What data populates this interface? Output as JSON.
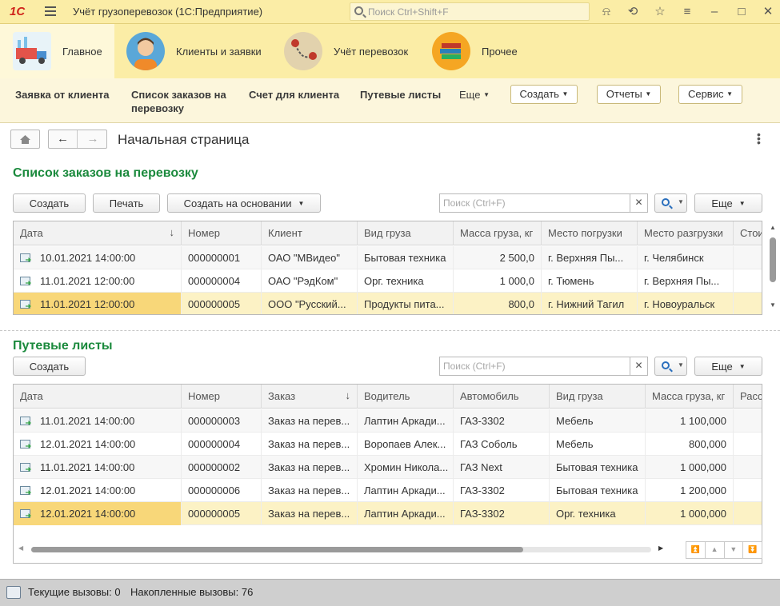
{
  "app": {
    "title": "Учёт грузоперевозок  (1С:Предприятие)",
    "search_placeholder": "Поиск Ctrl+Shift+F",
    "logo": "1С"
  },
  "sections": [
    {
      "label": "Главное",
      "icon": "truck-icon",
      "active": true
    },
    {
      "label": "Клиенты и заявки",
      "icon": "person-icon"
    },
    {
      "label": "Учёт перевозок",
      "icon": "route-icon"
    },
    {
      "label": "Прочее",
      "icon": "books-icon"
    }
  ],
  "commands": {
    "item1": "Заявка от клиента",
    "item2": "Список заказов на перевозку",
    "item3": "Счет для клиента",
    "item4": "Путевые листы",
    "more": "Еще",
    "create": "Создать",
    "reports": "Отчеты",
    "service": "Сервис"
  },
  "page": {
    "title": "Начальная страница"
  },
  "orders": {
    "title": "Список заказов на перевозку",
    "create": "Создать",
    "print": "Печать",
    "create_basis": "Создать на основании",
    "search_placeholder": "Поиск (Ctrl+F)",
    "more": "Еще",
    "columns": [
      "Дата",
      "Номер",
      "Клиент",
      "Вид груза",
      "Масса груза, кг",
      "Место погрузки",
      "Место разгрузки",
      "Стои"
    ],
    "rows": [
      [
        "10.01.2021 14:00:00",
        "000000001",
        "ОАО \"МВидео\"",
        "Бытовая техника",
        "2 500,0",
        "г. Верхняя Пы...",
        "г. Челябинск",
        ""
      ],
      [
        "11.01.2021 12:00:00",
        "000000004",
        "ОАО \"РэдКом\"",
        "Орг. техника",
        "1 000,0",
        "г. Тюмень",
        "г. Верхняя Пы...",
        ""
      ],
      [
        "11.01.2021 12:00:00",
        "000000005",
        "ООО \"Русский...",
        "Продукты пита...",
        "800,0",
        "г. Нижний Тагил",
        "г. Новоуральск",
        ""
      ]
    ]
  },
  "waybills": {
    "title": "Путевые листы",
    "create": "Создать",
    "search_placeholder": "Поиск (Ctrl+F)",
    "more": "Еще",
    "columns": [
      "Дата",
      "Номер",
      "Заказ",
      "Водитель",
      "Автомобиль",
      "Вид груза",
      "Масса груза, кг",
      "Расс"
    ],
    "rows": [
      [
        "11.01.2021 14:00:00",
        "000000003",
        "Заказ на перев...",
        "Лаптин Аркади...",
        "ГАЗ-3302",
        "Мебель",
        "1 100,000",
        ""
      ],
      [
        "12.01.2021 14:00:00",
        "000000004",
        "Заказ на перев...",
        "Воропаев Алек...",
        "ГАЗ Соболь",
        "Мебель",
        "800,000",
        ""
      ],
      [
        "11.01.2021 14:00:00",
        "000000002",
        "Заказ на перев...",
        "Хромин Никола...",
        "ГАЗ Next",
        "Бытовая техника",
        "1 000,000",
        ""
      ],
      [
        "12.01.2021 14:00:00",
        "000000006",
        "Заказ на перев...",
        "Лаптин Аркади...",
        "ГАЗ-3302",
        "Бытовая техника",
        "1 200,000",
        ""
      ],
      [
        "12.01.2021 14:00:00",
        "000000005",
        "Заказ на перев...",
        "Лаптин Аркади...",
        "ГАЗ-3302",
        "Орг. техника",
        "1 000,000",
        ""
      ]
    ]
  },
  "status": {
    "current_calls": "Текущие вызовы: 0",
    "accumulated_calls": "Накопленные вызовы: 76"
  },
  "colors": {
    "accent_green": "#1b8a3d",
    "panel_yellow": "#fbeda6",
    "selection": "#f8d779"
  }
}
